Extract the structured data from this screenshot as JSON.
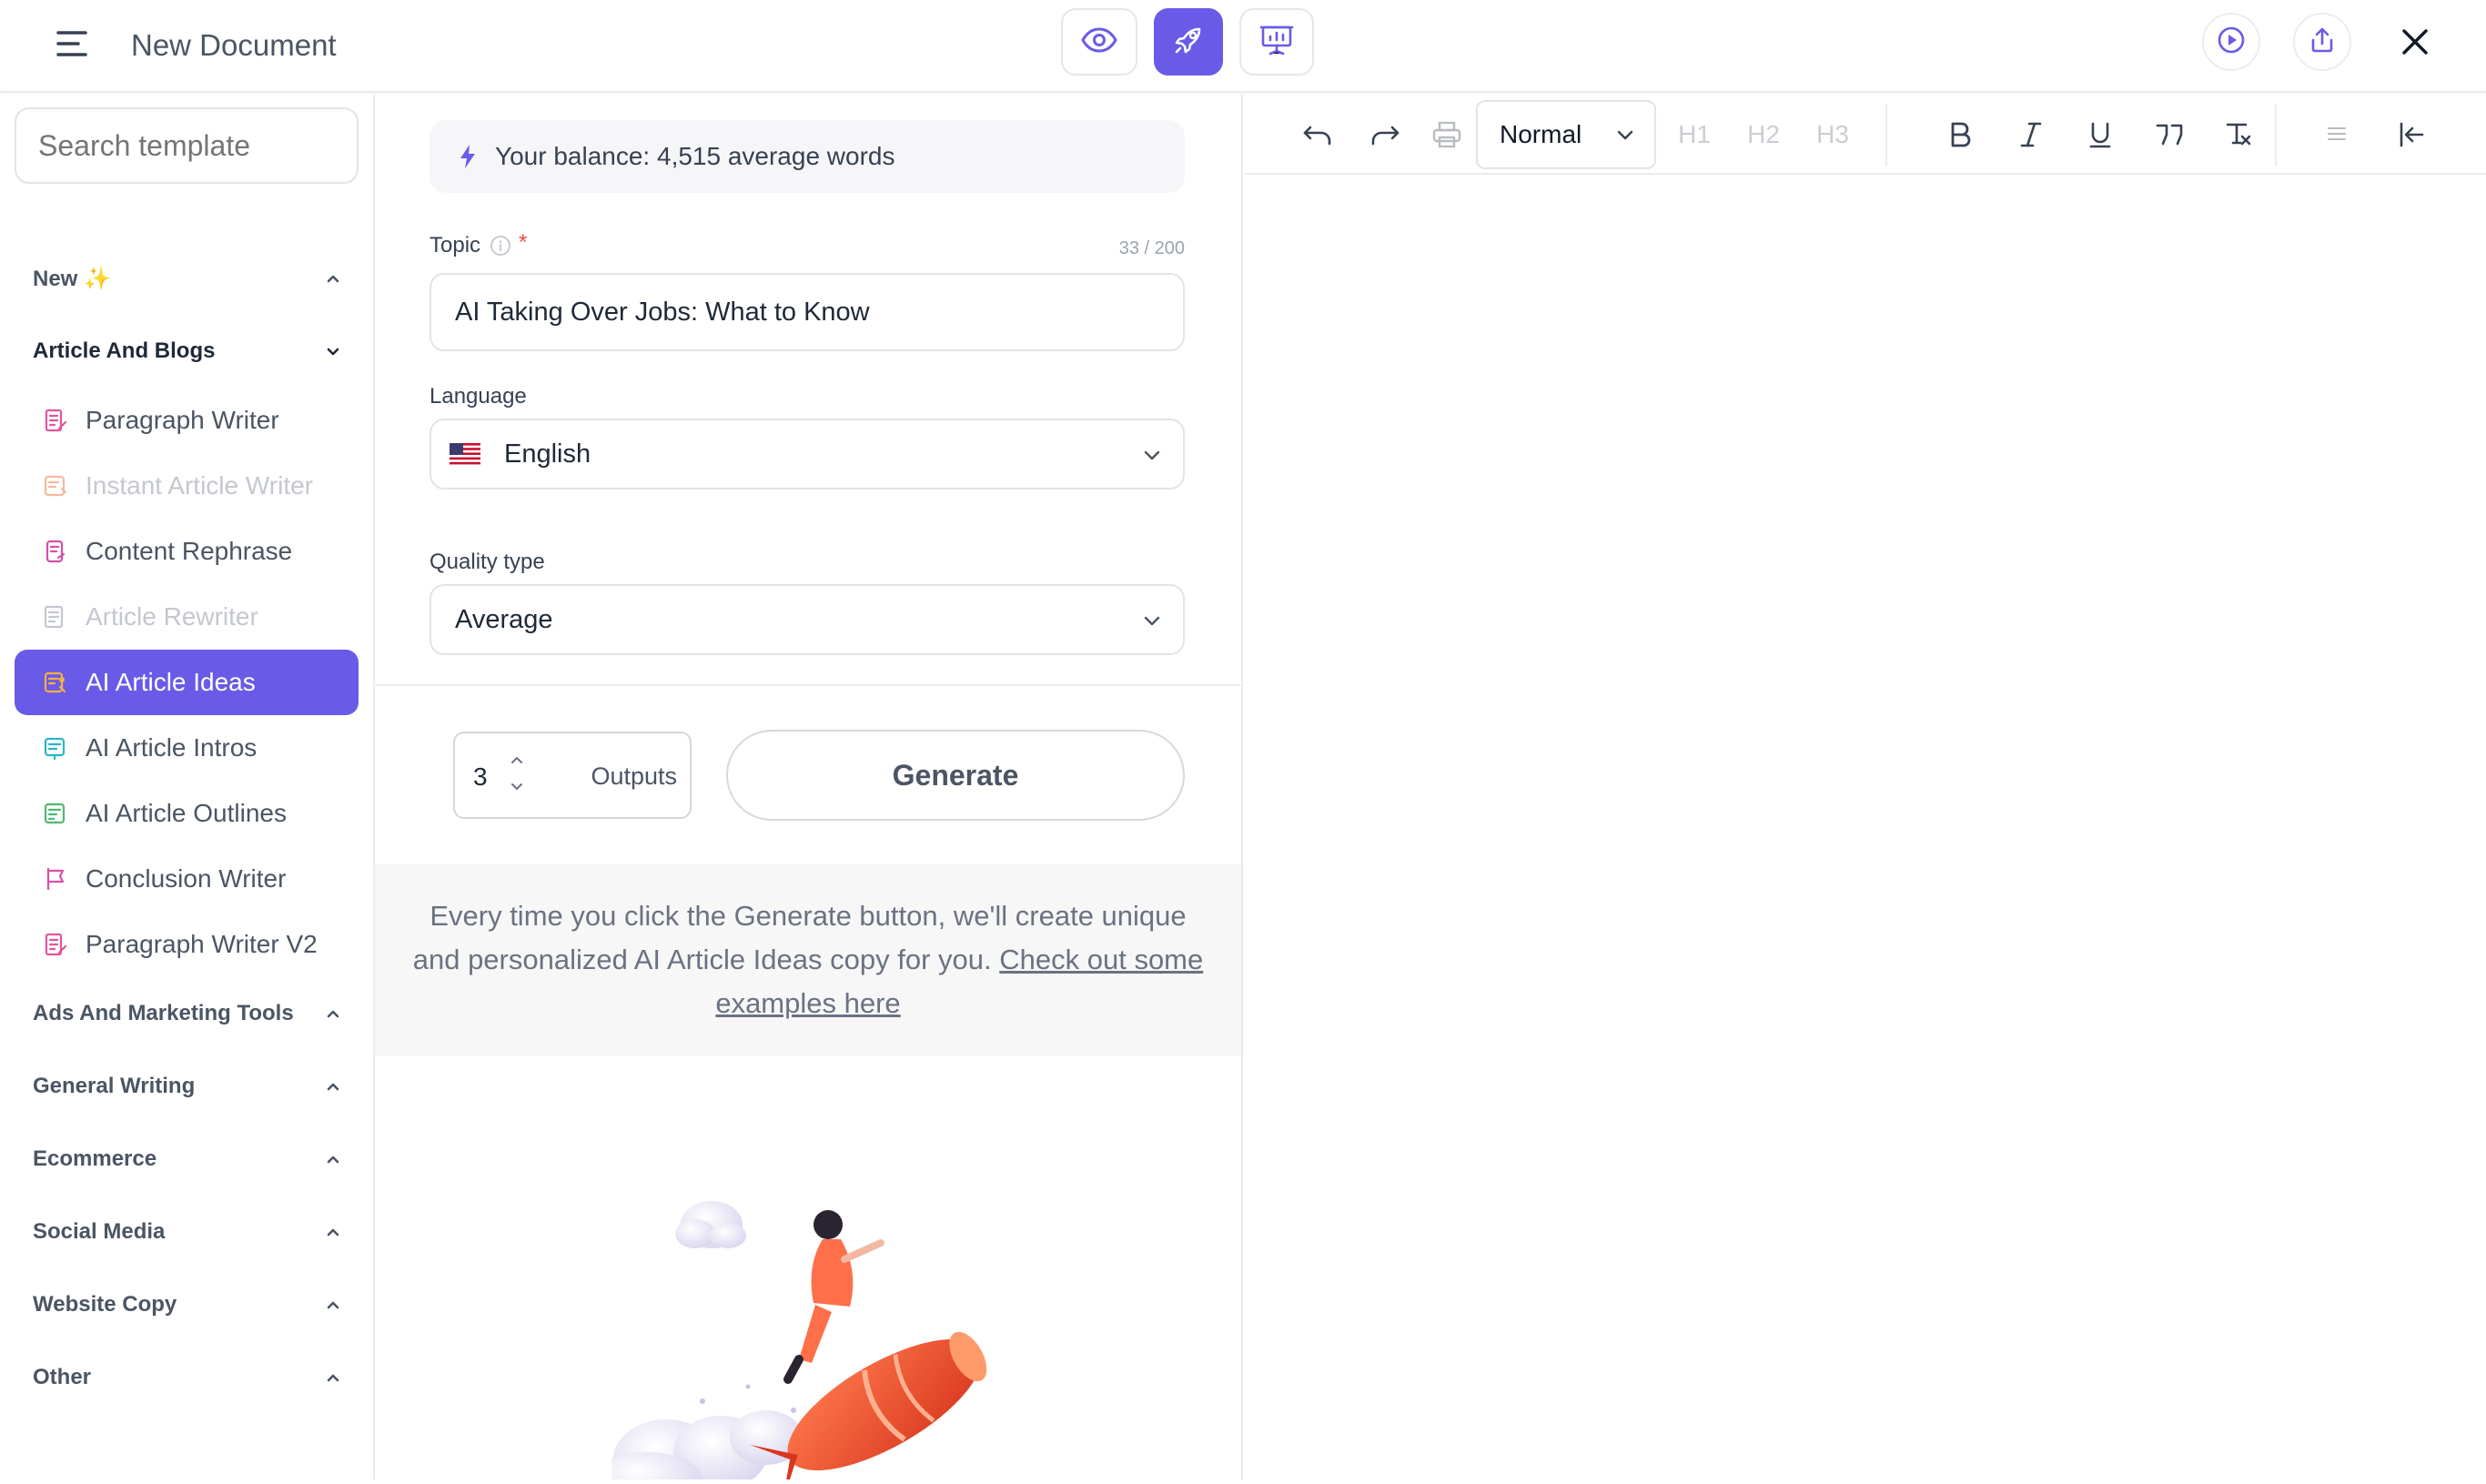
{
  "header": {
    "doc_title": "New Document",
    "accent_color": "#6a5ae8"
  },
  "sidebar": {
    "search_placeholder": "Search template",
    "new_label": "New ✨",
    "article_blogs_label": "Article And Blogs",
    "items": [
      {
        "label": "Paragraph Writer",
        "icon": "document-pen-icon",
        "state": "normal"
      },
      {
        "label": "Instant Article Writer",
        "icon": "article-spark-icon",
        "state": "disabled"
      },
      {
        "label": "Content Rephrase",
        "icon": "rephrase-icon",
        "state": "normal"
      },
      {
        "label": "Article Rewriter",
        "icon": "rewrite-icon",
        "state": "disabled"
      },
      {
        "label": "AI Article Ideas",
        "icon": "ideas-icon",
        "state": "active"
      },
      {
        "label": "AI Article Intros",
        "icon": "intro-icon",
        "state": "normal"
      },
      {
        "label": "AI Article Outlines",
        "icon": "outline-icon",
        "state": "normal"
      },
      {
        "label": "Conclusion Writer",
        "icon": "flag-icon",
        "state": "normal"
      },
      {
        "label": "Paragraph Writer V2",
        "icon": "document-pen-icon",
        "state": "normal"
      }
    ],
    "categories": [
      "Ads And Marketing Tools",
      "General Writing",
      "Ecommerce",
      "Social Media",
      "Website Copy",
      "Other"
    ]
  },
  "form": {
    "balance": "Your balance: 4,515 average words",
    "topic_label": "Topic",
    "required_mark": "*",
    "topic_counter": "33 / 200",
    "topic_value": "AI Taking Over Jobs: What to Know",
    "language_label": "Language",
    "language_value": "English",
    "quality_label": "Quality type",
    "quality_value": "Average",
    "outputs_value": "3",
    "outputs_label": "Outputs",
    "generate_label": "Generate",
    "info_text": "Every time you click the Generate button, we'll create unique and personalized AI Article Ideas copy for you.",
    "info_link": "Check out some examples here"
  },
  "editor": {
    "format_value": "Normal",
    "h1": "H1",
    "h2": "H2",
    "h3": "H3"
  }
}
